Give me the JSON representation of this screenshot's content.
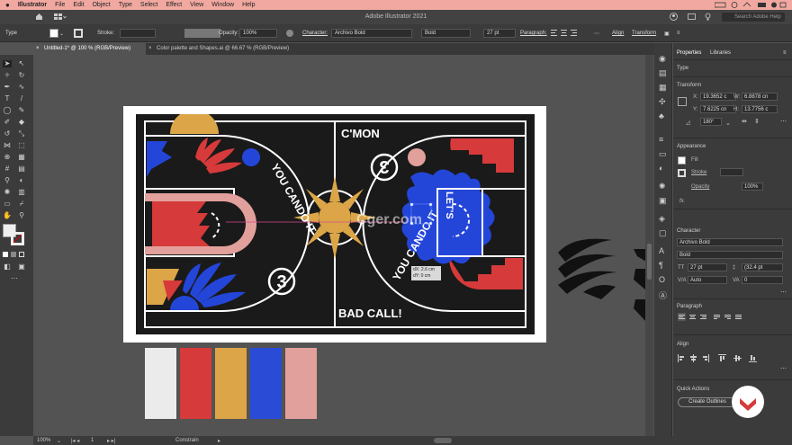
{
  "menubar": {
    "apple": "",
    "app": "Illustrator",
    "items": [
      "File",
      "Edit",
      "Object",
      "Type",
      "Select",
      "Effect",
      "View",
      "Window",
      "Help"
    ]
  },
  "appbar": {
    "title": "Adobe Illustrator 2021",
    "search_placeholder": "Search Adobe Help"
  },
  "control_bar": {
    "type_label": "Type",
    "stroke_label": "Stroke:",
    "opacity_label": "Opacity:",
    "opacity_value": "100%",
    "character_label": "Character:",
    "font_family": "Archivo Bold",
    "font_style": "Bold",
    "font_size": "27 pt",
    "paragraph_label": "Paragraph:",
    "align_label": "Align",
    "transform_label": "Transform"
  },
  "tabs": [
    {
      "label": "Untitled-1* @ 100 % (RGB/Preview)",
      "active": true
    },
    {
      "label": "Color palette and Shapes.ai @ 66.67 % (RGB/Preview)",
      "active": false
    }
  ],
  "artwork": {
    "top_text": "C'MON",
    "bottom_text": "BAD CALL!",
    "arc_text_left": "YOU CANDO IT",
    "arc_text_right": "YOU CANDO IT",
    "lets_text": "LET'S",
    "number_left": "3",
    "number_right": "3",
    "tooltip_dx": "dX: 2.6 cm",
    "tooltip_dy": "dY: 0 cm"
  },
  "swatches": [
    "#ebebeb",
    "#d63a3a",
    "#dba548",
    "#2a4bd6",
    "#e2a09c"
  ],
  "colors": {
    "red": "#d63a3a",
    "yellow": "#dba548",
    "blue": "#2446d8",
    "pink": "#e2a09c",
    "court": "#1a1a1a",
    "court_line": "#ffffff"
  },
  "panel": {
    "tabs": [
      "Properties",
      "Libraries"
    ],
    "type_section": "Type",
    "transform_section": "Transform",
    "x_label": "X:",
    "x_value": "19.3652 c",
    "y_label": "Y:",
    "y_value": "7.6225 cn",
    "w_label": "W:",
    "w_value": "6.8878 cn",
    "h_label": "H:",
    "h_value": "13.7756 c",
    "rotation": "180°",
    "appearance_section": "Appearance",
    "fill_label": "Fill",
    "stroke_label": "Stroke",
    "opacity_label": "Opacity",
    "opacity_value": "100%",
    "fx_label": "fx.",
    "character_section": "Character",
    "font_family": "Archivo Bold",
    "font_style": "Bold",
    "font_size": "27 pt",
    "leading": "(32.4 pt",
    "kerning": "Auto",
    "tracking": "0",
    "tracking2": "0",
    "paragraph_section": "Paragraph",
    "align_section": "Align",
    "quick_actions_section": "Quick Actions",
    "create_outlines": "Create Outlines"
  },
  "statusbar": {
    "zoom": "100%",
    "artboard": "1",
    "mode": "Constrain"
  },
  "watermark": "Cger.com"
}
